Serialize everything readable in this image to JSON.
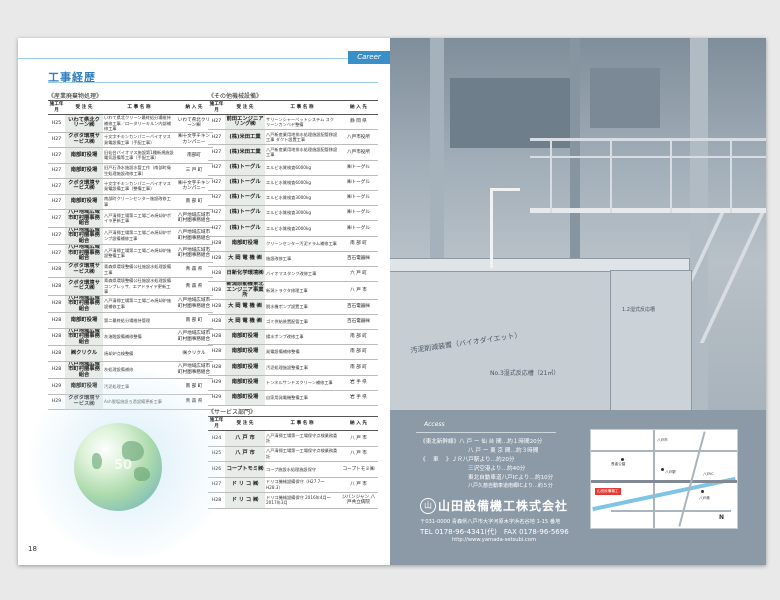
{
  "left_page": {
    "career_tab": "Career",
    "section_title": "工事経歴",
    "page_number": "18",
    "globe_text": "50",
    "table1": {
      "label": "《産業廃棄物処理》",
      "headers": [
        "施工年月",
        "受 注 先",
        "工 事 名 称",
        "納 入 先"
      ],
      "rows": [
        [
          "H25",
          "いわて県北クリーン㈱",
          "いわて県北クリーン最終処分場維持補修工事／ロータリーキルン内部補修工事",
          "いわて県北クリーン㈱"
        ],
        [
          "H27",
          "クボタ環境サービス㈱",
          "十文字チキンカンパニーバイオマス発電設備工事（手配工事）",
          "㈱十文字チキンカンパニー"
        ],
        [
          "H27",
          "南部町役場",
          "旧仙台バイオマス施設第1種新規施設電気設備等工事（手配工事）",
          "南部町"
        ],
        [
          "H27",
          "南部町役場",
          "旧戸石浄水施設水管工作（南部町衛生処理施設改修工事）",
          "三 戸 町"
        ],
        [
          "H27",
          "クボタ環境サービス㈱",
          "十文字チキンカンパニーバイオマス発電設備工事（整備工事）",
          "㈱十文字チキンカンパニー"
        ],
        [
          "H27",
          "南部町役場",
          "南部町クリーンセンター施設改修工事",
          "南 部 町"
        ],
        [
          "H27",
          "八戸地域広域市町村圏事務組合",
          "八戸清掃工場第二工場ごみ焼却炉ボイラ更新工事",
          "八戸地域広域市町村圏事務組合"
        ],
        [
          "H27",
          "八戸地域広域市町村圏事務組合",
          "八戸清掃工場第二工場ごみ焼却炉ポンプ設備補修工事",
          "八戸地域広域市町村圏事務組合"
        ],
        [
          "H27",
          "八戸地域広域市町村圏事務組合",
          "八戸清掃工場第二工場ごみ焼却炉施設整備工事",
          "八戸地域広域市町村圏事務組合"
        ],
        [
          "H28",
          "クボタ環境サービス㈱",
          "青森県環境整備公社施設水処理設備工事",
          "青 森 県"
        ],
        [
          "H28",
          "クボタ環境サービス㈱",
          "青森県環境整備公社施設水処理設備コンプレッサ、エアドライヤ更新工事",
          "青 森 県"
        ],
        [
          "H28",
          "八戸地域広域市町村圏事務組合",
          "八戸清掃工場第二工場ごみ焼却炉施設補修工事",
          "八戸地域広域市町村圏事務組合"
        ],
        [
          "H28",
          "南部町役場",
          "第二最終処分場維持管理",
          "南 部 町"
        ],
        [
          "H28",
          "八戸地域広域市町村圏事務組合",
          "灰溶融設備補修整備",
          "八戸地域広域市町村圏事務組合"
        ],
        [
          "H28",
          "㈱クリクル",
          "焼却炉点検整備",
          "㈱クリクル"
        ],
        [
          "H28",
          "八戸地域広域市町村圏事務組合",
          "灰処理設備補修",
          "八戸地域広域市町村圏事務組合"
        ],
        [
          "H29",
          "南部町役場",
          "汚泥処理工事",
          "南 部 町"
        ],
        [
          "H29",
          "クボタ環境サービス㈱",
          "Ash脱塩施設ろ過設備更新工事",
          "青 森 県"
        ]
      ]
    },
    "table2": {
      "label": "《その他機械設備》",
      "headers": [
        "施工年月",
        "受 注 先",
        "工 事 名 称",
        "納 入 先"
      ],
      "rows": [
        [
          "H27",
          "前田エンジニアリング㈱",
          "サリーンシャーベットシステム スクリーンカンベヤ整備",
          "静 岡 県"
        ],
        [
          "H27",
          "(株)米田工業",
          "八戸新産業用地排水処理施設配管移設工事 ダクト設置工事",
          "八戸市役所"
        ],
        [
          "H27",
          "(株)米田工業",
          "八戸新産業用地排水処理施設配管移設工事",
          "八戸市役所"
        ],
        [
          "H27",
          "(株)トーグル",
          "エルビ水質検査6000kg",
          "㈱トーグル"
        ],
        [
          "H27",
          "(株)トーグル",
          "エルビ水質検査6000kg",
          "㈱トーグル"
        ],
        [
          "H27",
          "(株)トーグル",
          "エルビ水質検査3000kg",
          "㈱トーグル"
        ],
        [
          "H27",
          "(株)トーグル",
          "エルビ水質検査3000kg",
          "㈱トーグル"
        ],
        [
          "H27",
          "(株)トーグル",
          "エルビ水質検査2000kg",
          "㈱トーグル"
        ],
        [
          "H28",
          "南部町役場",
          "クリーンセンター汚泥ドラム補修工事",
          "南 部 町"
        ],
        [
          "H28",
          "大 岡 電 機 ㈱",
          "施設改修工事",
          "百石電器㈱"
        ],
        [
          "H28",
          "日新化学環境㈱",
          "バイオマスタンク改修工事",
          "六 戸 町"
        ],
        [
          "H28",
          "新潟原動機東北エンジニア事業所",
          "新潟トラクタ修理工事",
          "八 戸 市"
        ],
        [
          "H28",
          "大 岡 電 機 ㈱",
          "脱水機ポンプ設置工事",
          "百石電器㈱"
        ],
        [
          "H28",
          "大 岡 電 機 ㈱",
          "ゴミ供給装置配管工事",
          "百石電器㈱"
        ],
        [
          "H28",
          "南部町役場",
          "揚水ポンプ改修工事",
          "南 部 町"
        ],
        [
          "H28",
          "南部町役場",
          "発電設備補修整備",
          "南 部 町"
        ],
        [
          "H28",
          "南部町役場",
          "汚泥処理施設整備工事",
          "南 部 町"
        ],
        [
          "H29",
          "南部町役場",
          "トンネルサンドスクリーン補修工事",
          "岩 手 県"
        ],
        [
          "H29",
          "南部町役場",
          "自家用発電機整備工事",
          "岩 手 県"
        ]
      ]
    },
    "table3": {
      "label": "《サービス部門》",
      "headers": [
        "施工年月",
        "受 注 先",
        "工 事 名 称",
        "納 入 先"
      ],
      "rows": [
        [
          "H24",
          "八 戸 市",
          "八戸清掃工場第一工場保守点検業務委託",
          "八 戸 市"
        ],
        [
          "H25",
          "八 戸 市",
          "八戸清掃工場第一工場保守点検業務委託",
          "八 戸 市"
        ],
        [
          "H26",
          "コープトモミ㈱",
          "コープ施設水処理施設保守",
          "コープトモミ㈱"
        ],
        [
          "H27",
          "ド リ コ ㈱",
          "ドリコ機械設備保守（H27.7〜H28.3）",
          "八 戸 市"
        ],
        [
          "H28",
          "ド リ コ ㈱",
          "ドリコ機械設備保守 2016年4月〜2017年3月",
          "ジバンジャン 八戸共立病院"
        ]
      ]
    }
  },
  "right_page": {
    "tank_label_1": "汚泥削減装置（バイオダイエット）",
    "tank_label_2": "No.3湿式反応槽（21㎥）",
    "tank_label_3": "1.2湿式反応槽",
    "access": {
      "label": "Access",
      "lines": [
        "《東北新幹線》八 戸 ー 仙 台 間…約１時間20分",
        "八 戸 ー 東 京 間…約３時間",
        "《　 車　 》ＪＲ八戸駅より…約20分",
        "三沢空港より…約40分",
        "東北自動車道八戸ICより…約10分",
        "八戸久慈自動車道南郷ICより…約５分"
      ]
    },
    "map": {
      "labels": [
        "長者公園",
        "八戸市",
        "八戸駅",
        "八戸IC",
        "山田設備機工",
        "八戸港",
        "N"
      ]
    },
    "company": {
      "logo_char": "山",
      "name": "山田設備機工株式会社",
      "address": "〒031-0000 青森県八戸市大字河原木字浜名谷地 1-15 番地",
      "tel": "TEL 0178-96-4341(代)　FAX 0178-96-5696",
      "url": "http://www.yamada-setsubi.com"
    }
  }
}
